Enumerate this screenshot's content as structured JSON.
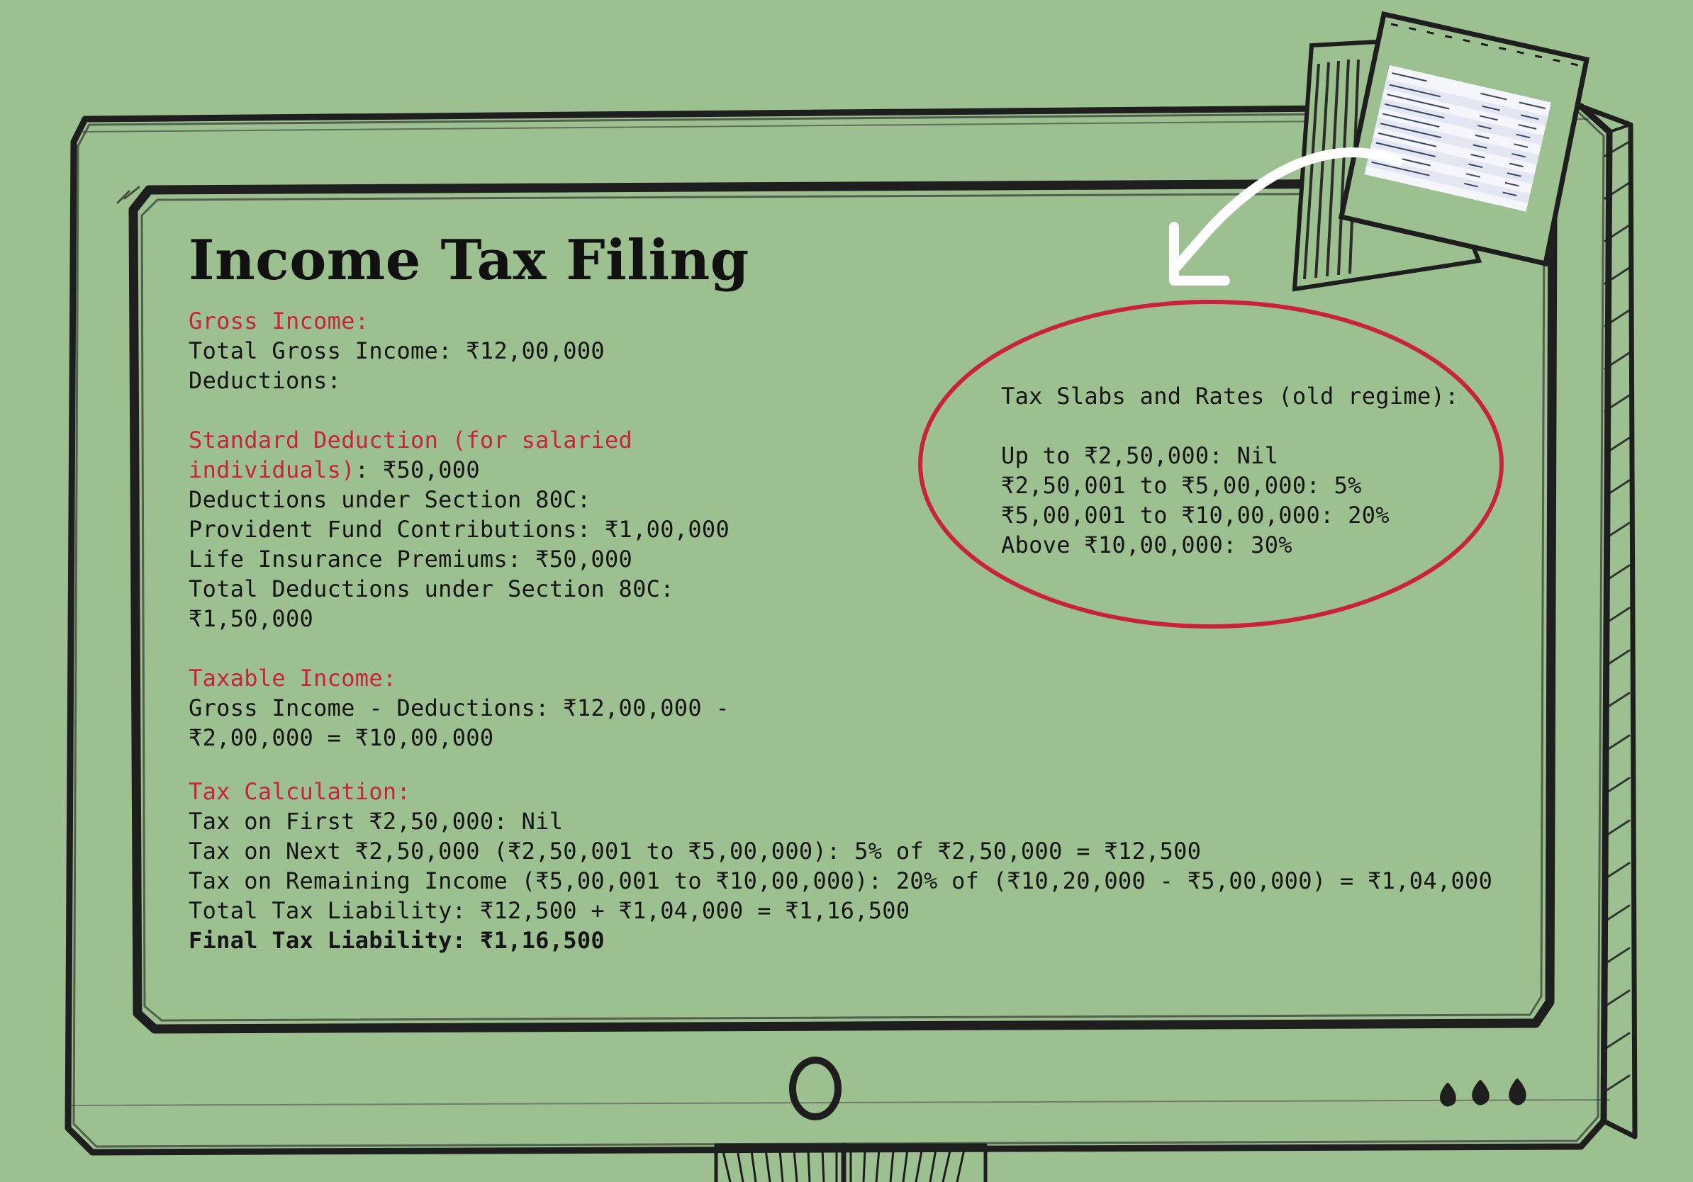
{
  "title": "Income Tax Filing",
  "gross_income": {
    "heading": "Gross Income:",
    "total": "Total Gross Income: ₹12,00,000",
    "deductions_label": "Deductions:"
  },
  "standard_deduction": {
    "heading_part1": "Standard Deduction (for salaried",
    "heading_part2": "individuals)",
    "amount": ": ₹50,000",
    "section80c_label": "Deductions under Section 80C:",
    "pf": "Provident Fund Contributions: ₹1,00,000",
    "life_insurance": "Life Insurance Premiums: ₹50,000",
    "total_80c_label": "Total Deductions under Section 80C:",
    "total_80c_value": "₹1,50,000"
  },
  "taxable_income": {
    "heading": "Taxable Income:",
    "line1": "Gross Income - Deductions: ₹12,00,000 -",
    "line2": "₹2,00,000 = ₹10,00,000"
  },
  "tax_calculation": {
    "heading": "Tax Calculation:",
    "lines": [
      "Tax on First ₹2,50,000: Nil",
      "Tax on Next ₹2,50,000 (₹2,50,001 to ₹5,00,000): 5% of ₹2,50,000 = ₹12,500",
      "Tax on Remaining Income (₹5,00,001 to ₹10,00,000): 20% of (₹10,20,000 - ₹5,00,000) = ₹1,04,000",
      "Total Tax Liability: ₹12,500 + ₹1,04,000 = ₹1,16,500"
    ],
    "final": "Final Tax Liability: ₹1,16,500"
  },
  "tax_slabs": {
    "heading": "Tax Slabs and Rates (old regime):",
    "lines": [
      "Up to ₹2,50,000: Nil",
      "₹2,50,001 to ₹5,00,000: 5%",
      "₹5,00,001 to ₹10,00,000: 20%",
      "Above ₹10,00,000: 30%"
    ]
  },
  "colors": {
    "background": "#9dc091",
    "accent_red": "#c8233a",
    "sketch_ink": "#1e1e1e",
    "arrow": "#ffffff"
  },
  "icons": {
    "monitor": "sketched-monitor-frame",
    "power_button": "power-button-icon",
    "indicator_lights": "indicator-lights-icon",
    "note": "tax-table-note-icon",
    "arrow": "curved-arrow-icon",
    "highlight": "red-ellipse-highlight"
  }
}
